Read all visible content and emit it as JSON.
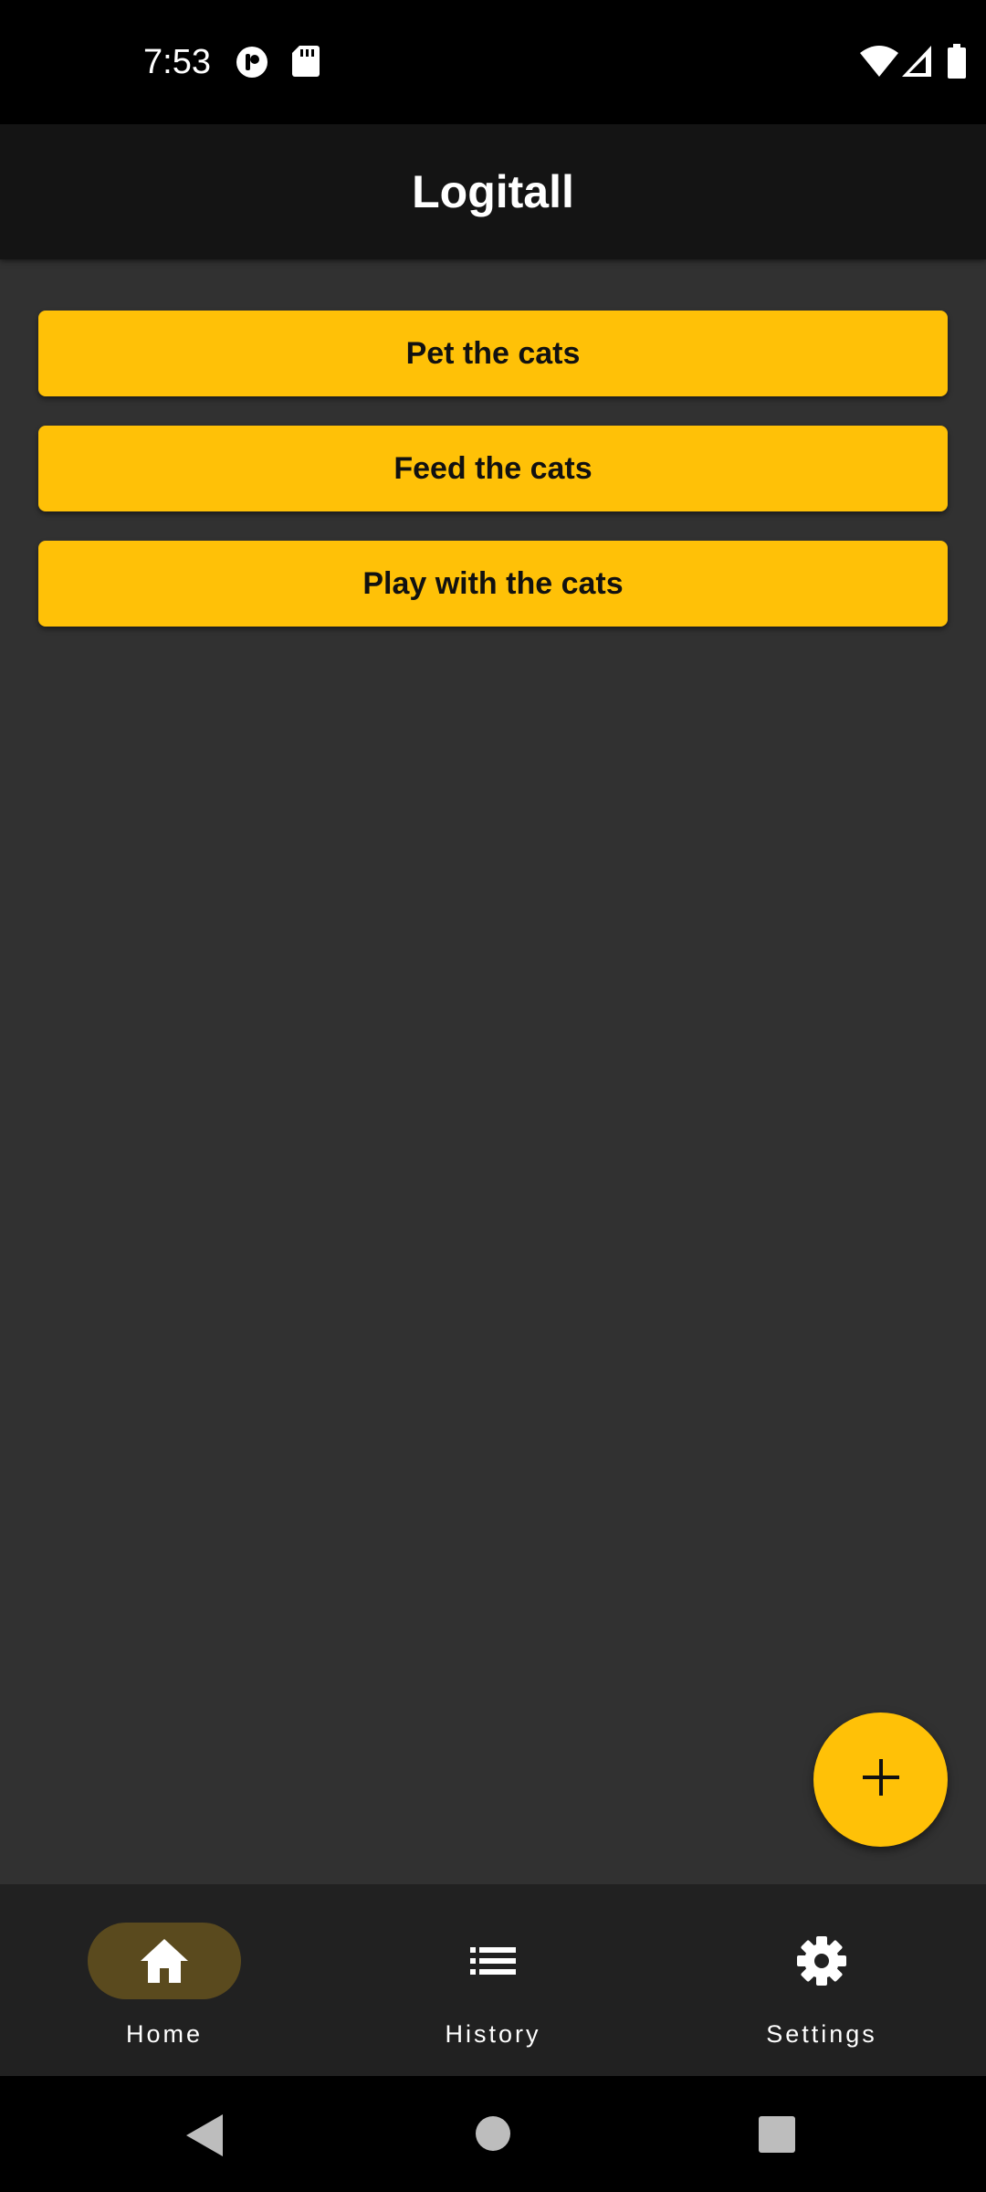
{
  "status_bar": {
    "time": "7:53",
    "left_icons": [
      "data-saver-icon",
      "sd-card-icon"
    ],
    "right_icons": [
      "wifi-icon",
      "cell-signal-icon",
      "battery-icon"
    ]
  },
  "app_bar": {
    "title": "Logitall"
  },
  "tasks": [
    {
      "label": "Pet the cats"
    },
    {
      "label": "Feed the cats"
    },
    {
      "label": "Play with the cats"
    }
  ],
  "fab": {
    "icon": "plus-icon",
    "color": "#FFC107"
  },
  "bottom_nav": {
    "selected": "Home",
    "items": [
      {
        "label": "Home",
        "icon": "home-icon"
      },
      {
        "label": "History",
        "icon": "list-icon"
      },
      {
        "label": "Settings",
        "icon": "gear-icon"
      }
    ]
  },
  "system_nav": {
    "buttons": [
      "back-icon",
      "home-circle-icon",
      "recents-icon"
    ]
  },
  "colors": {
    "accent": "#FFC107",
    "background": "#313131",
    "app_bar": "#141414",
    "nav_bar": "#212121",
    "nav_indicator": "#5A4A1E"
  }
}
